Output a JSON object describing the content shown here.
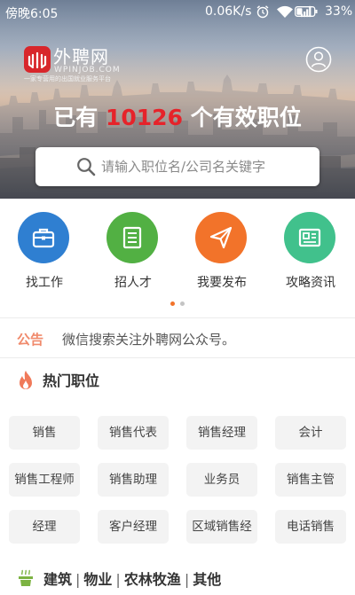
{
  "status_bar": {
    "time": "傍晚6:05",
    "net_speed": "0.06K/s",
    "battery": "33%",
    "icons": [
      "alarm-icon",
      "wifi-icon",
      "signal-icon",
      "battery-icon"
    ]
  },
  "header": {
    "logo_text": "外聘网",
    "logo_url_text": "WPINJOB.COM",
    "logo_slogan": "一家专营用的出国就业服务平台",
    "headline_prefix": "已有",
    "job_count": "10126",
    "headline_suffix": "个有效职位",
    "user_icon": "user-icon"
  },
  "search": {
    "placeholder": "请输入职位名/公司名关键字"
  },
  "quick_menu": [
    {
      "label": "找工作",
      "icon": "briefcase-icon",
      "color": "#2f7fd1"
    },
    {
      "label": "招人才",
      "icon": "list-icon",
      "color": "#52b043"
    },
    {
      "label": "我要发布",
      "icon": "paper-plane-icon",
      "color": "#f2732a"
    },
    {
      "label": "攻略资讯",
      "icon": "news-icon",
      "color": "#41c18c"
    }
  ],
  "pager": {
    "active_color": "#f2732a",
    "inactive_color": "#c4c4c4"
  },
  "notice": {
    "tag": "公告",
    "text": "微信搜索关注外聘网公众号。"
  },
  "hot_jobs": {
    "title": "热门职位",
    "items": [
      "销售",
      "销售代表",
      "销售经理",
      "会计",
      "销售工程师",
      "销售助理",
      "业务员",
      "销售主管",
      "经理",
      "客户经理",
      "区域销售经",
      "电话销售"
    ]
  },
  "categories": {
    "items": [
      "建筑",
      "物业",
      "农林牧渔",
      "其他"
    ],
    "separator": "|"
  },
  "colors": {
    "brand_red": "#e6232a",
    "notice_tag": "#f08a6c",
    "flame": "#f07a5a",
    "category_icon": "#7cb342"
  }
}
